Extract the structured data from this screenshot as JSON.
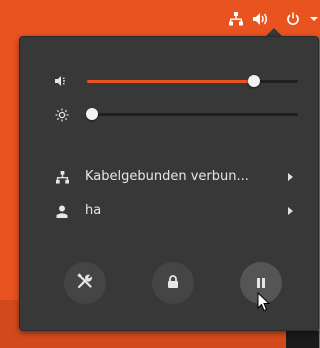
{
  "topbar": {
    "icons": [
      "network-wired-icon",
      "volume-icon",
      "power-icon",
      "chevron-down-icon"
    ]
  },
  "menu": {
    "volume": {
      "icon": "volume-icon",
      "level": 0.79
    },
    "brightness": {
      "icon": "brightness-icon",
      "level": 0.0
    },
    "network": {
      "icon": "network-wired-icon",
      "label": "Kabelgebunden verbun..."
    },
    "user": {
      "icon": "user-icon",
      "label": "ha"
    },
    "actions": [
      {
        "name": "settings",
        "icon": "tools-icon"
      },
      {
        "name": "lock",
        "icon": "lock-icon"
      },
      {
        "name": "suspend",
        "icon": "pause-icon"
      }
    ]
  },
  "colors": {
    "accent": "#e95420",
    "menu_bg": "#383838",
    "desktop": "#e85320"
  }
}
